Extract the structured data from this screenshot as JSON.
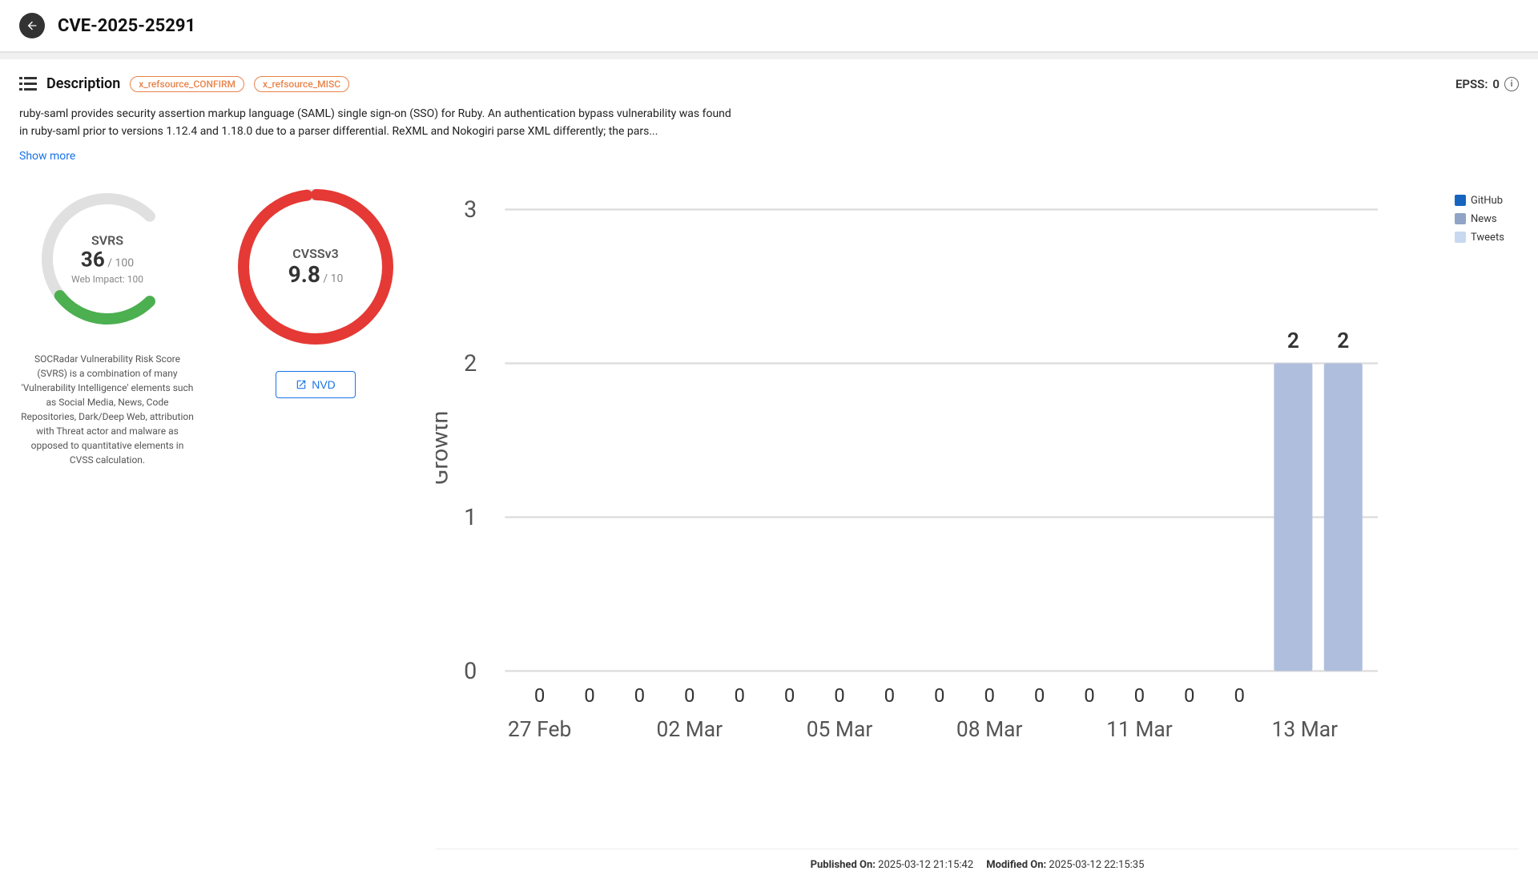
{
  "header": {
    "title": "CVE-2025-25291",
    "back_icon": "arrow-left"
  },
  "description": {
    "icon": "list-icon",
    "title": "Description",
    "tags": [
      "x_refsource_CONFIRM",
      "x_refsource_MISC"
    ],
    "epss_label": "EPSS:",
    "epss_value": "0",
    "text": "ruby-saml provides security assertion markup language (SAML) single sign-on (SSO) for Ruby. An authentication bypass vulnerability was found in ruby-saml prior to versions 1.12.4 and 1.18.0 due to a parser differential. ReXML and Nokogiri parse XML differently; the pars...",
    "show_more": "Show more"
  },
  "svrs": {
    "label": "SVRS",
    "value": "36",
    "max": "100",
    "web_impact_label": "Web Impact:",
    "web_impact_value": "100",
    "description": "SOCRadar Vulnerability Risk Score (SVRS) is a combination of many 'Vulnerability Intelligence' elements such as Social Media, News, Code Repositories, Dark/Deep Web, attribution with Threat actor and malware as opposed to quantitative elements in CVSS calculation.",
    "score_color": "#4caf50",
    "bg_color": "#e0e0e0"
  },
  "cvss": {
    "label": "CVSSv3",
    "value": "9.8",
    "max": "10",
    "score_color": "#e53935",
    "nvd_label": "NVD",
    "link_icon": "external-link-icon"
  },
  "chart": {
    "y_axis_label": "Growth",
    "y_ticks": [
      "0",
      "1",
      "2",
      "3"
    ],
    "x_labels": [
      "27 Feb",
      "02 Mar",
      "05 Mar",
      "08 Mar",
      "11 Mar",
      "13 Mar"
    ],
    "bar_labels": [
      "0",
      "0",
      "0",
      "0",
      "0",
      "0",
      "0",
      "0",
      "0",
      "0",
      "0",
      "0",
      "0",
      "0",
      "0",
      "2",
      "2"
    ],
    "top_values": {
      "col15": "2",
      "col16": "2"
    },
    "legend": [
      {
        "label": "GitHub",
        "color": "#1565c0"
      },
      {
        "label": "News",
        "color": "#90a4c8"
      },
      {
        "label": "Tweets",
        "color": "#c8d8f0"
      }
    ]
  },
  "footer": {
    "published_label": "Published On:",
    "published_value": "2025-03-12 21:15:42",
    "modified_label": "Modified On:",
    "modified_value": "2025-03-12 22:15:35"
  }
}
